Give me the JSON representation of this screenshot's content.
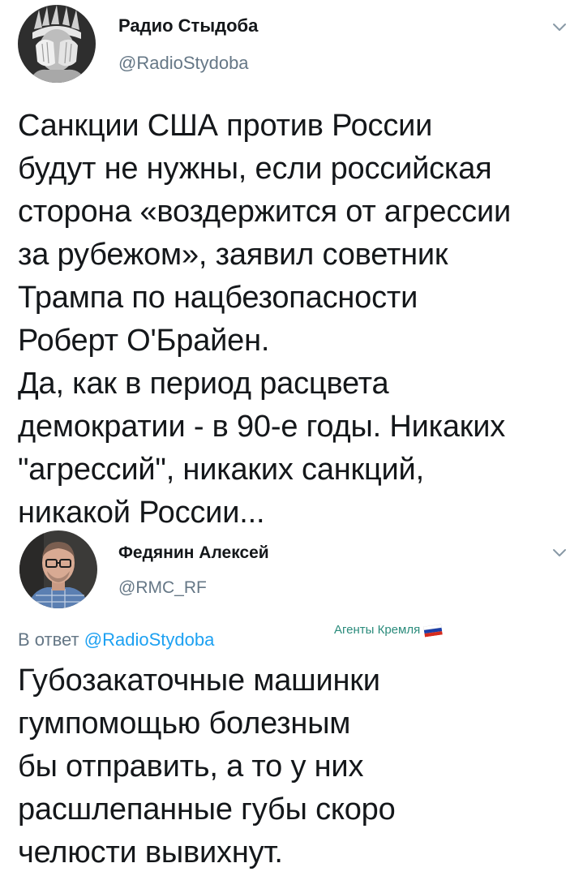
{
  "tweets": [
    {
      "author_name": "Радио Стыдоба",
      "author_handle": "@RadioStydoba",
      "text": "Санкции США против России\nбудут не нужны, если российская\nсторона «воздержится от агрессии\nза рубежом», заявил советник\nТрампа по нацбезопасности\nРоберт О'Брайен.\nДа, как в период расцвета\nдемократии - в 90-е годы. Никаких\n\"агрессий\", никаких санкций,\nникакой России..."
    },
    {
      "author_name": "Федянин Алексей",
      "author_handle": "@RMC_RF",
      "reply_prefix": "В ответ",
      "reply_to": "@RadioStydoba",
      "text": "Губозакаточные машинки\nгумпомощью болезным\nбы отправить, а то у них\nрасшлепанные губы скоро\nчелюсти вывихнут."
    }
  ],
  "watermark": {
    "text": "Агенты Кремля",
    "flag": "russian-flag-icon",
    "color": "#2a8b7b"
  },
  "colors": {
    "text": "#14171a",
    "secondary": "#657786",
    "link": "#1da1f2"
  }
}
